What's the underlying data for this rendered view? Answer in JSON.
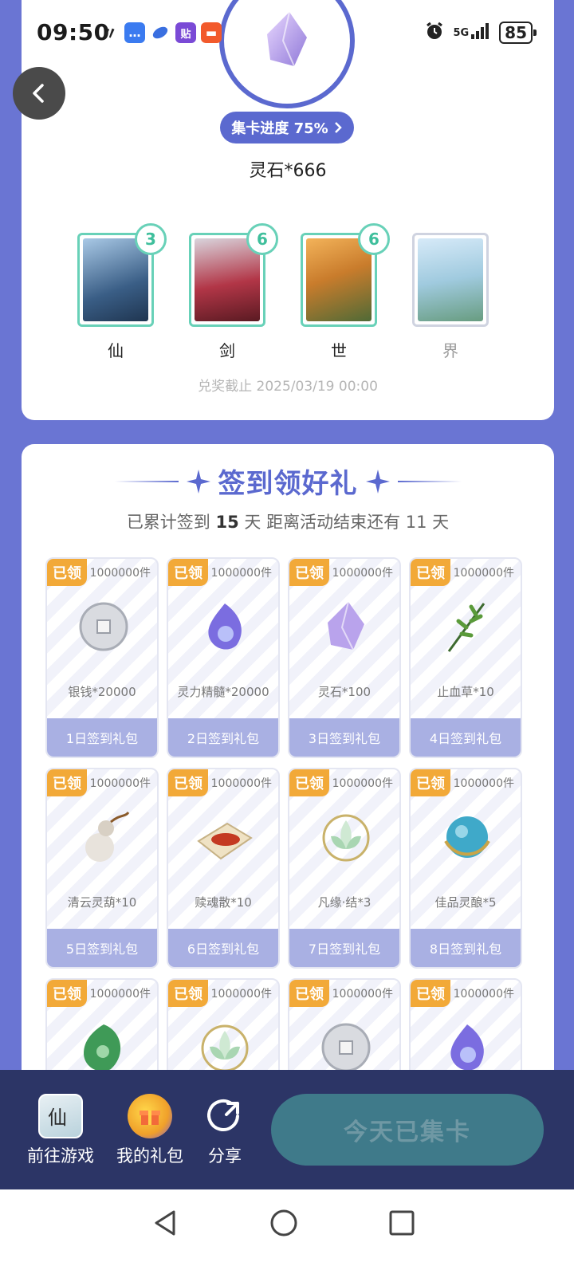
{
  "status_bar": {
    "time": "09:50",
    "network": "5G",
    "battery": "85"
  },
  "top": {
    "progress_label": "集卡进度 75%",
    "reward_name": "灵石*666",
    "cards": [
      {
        "label": "仙",
        "count": "3",
        "collected": true
      },
      {
        "label": "剑",
        "count": "6",
        "collected": true
      },
      {
        "label": "世",
        "count": "6",
        "collected": true
      },
      {
        "label": "界",
        "count": "",
        "collected": false
      }
    ],
    "deadline": "兑奖截止 2025/03/19 00:00"
  },
  "signin": {
    "title": "签到领好礼",
    "sub_prefix": "已累计签到",
    "days_signed": "15",
    "sub_mid": "天  距离活动结束还有 11 天",
    "gifts": [
      {
        "tag": "已领",
        "qty": "1000000件",
        "name": "银钱*20000",
        "label": "1日签到礼包",
        "icon": "silver-coin-icon"
      },
      {
        "tag": "已领",
        "qty": "1000000件",
        "name": "灵力精髓*20000",
        "label": "2日签到礼包",
        "icon": "spirit-essence-icon"
      },
      {
        "tag": "已领",
        "qty": "1000000件",
        "name": "灵石*100",
        "label": "3日签到礼包",
        "icon": "spirit-stone-icon"
      },
      {
        "tag": "已领",
        "qty": "1000000件",
        "name": "止血草*10",
        "label": "4日签到礼包",
        "icon": "herb-icon"
      },
      {
        "tag": "已领",
        "qty": "1000000件",
        "name": "清云灵葫*10",
        "label": "5日签到礼包",
        "icon": "gourd-icon"
      },
      {
        "tag": "已领",
        "qty": "1000000件",
        "name": "赎魂散*10",
        "label": "6日签到礼包",
        "icon": "powder-icon"
      },
      {
        "tag": "已领",
        "qty": "1000000件",
        "name": "凡缘·结*3",
        "label": "7日签到礼包",
        "icon": "lotus-icon"
      },
      {
        "tag": "已领",
        "qty": "1000000件",
        "name": "佳品灵酿*5",
        "label": "8日签到礼包",
        "icon": "orb-icon"
      },
      {
        "tag": "已领",
        "qty": "1000000件",
        "name": "",
        "label": "",
        "icon": "jade-icon"
      },
      {
        "tag": "已领",
        "qty": "1000000件",
        "name": "",
        "label": "",
        "icon": "lotus-icon"
      },
      {
        "tag": "已领",
        "qty": "1000000件",
        "name": "",
        "label": "",
        "icon": "silver-coin-icon"
      },
      {
        "tag": "已领",
        "qty": "1000000件",
        "name": "",
        "label": "",
        "icon": "spirit-essence-icon"
      }
    ]
  },
  "bottom_bar": {
    "game_label": "前往游戏",
    "gift_label": "我的礼包",
    "share_label": "分享",
    "cta_label": "今天已集卡"
  },
  "colors": {
    "accent": "#5b69cf",
    "background": "#6a75d3",
    "tag": "#f2a938",
    "card_border": "#68d1b8"
  }
}
